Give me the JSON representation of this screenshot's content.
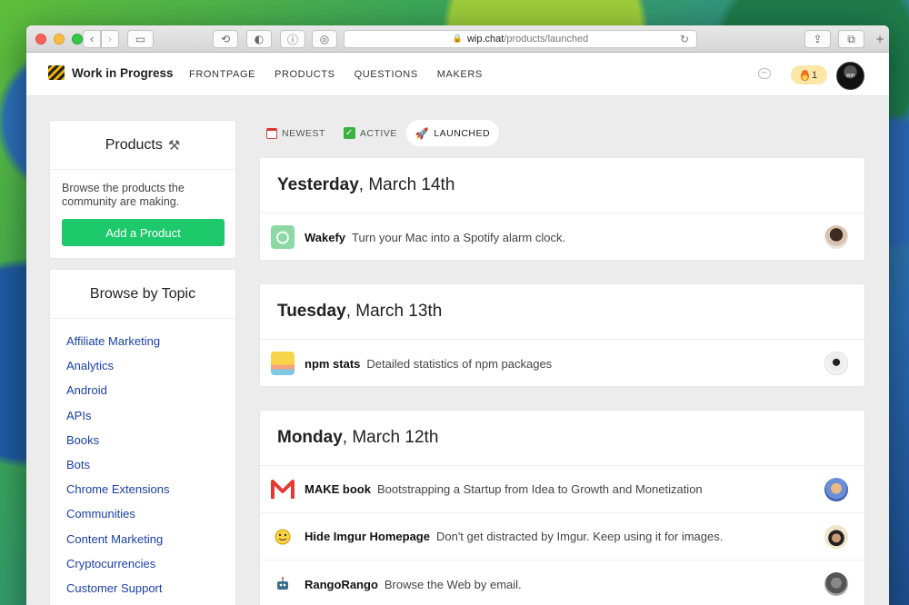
{
  "browser": {
    "url_domain": "wip.chat",
    "url_path": "/products/launched"
  },
  "header": {
    "logo_text": "Work in Progress",
    "nav": [
      "FRONTPAGE",
      "PRODUCTS",
      "QUESTIONS",
      "MAKERS"
    ],
    "streak_count": "1",
    "avatar_text": "WIP"
  },
  "sidebar": {
    "products_title": "Products",
    "products_desc": "Browse the products the community are making.",
    "add_button": "Add a Product",
    "topics_title": "Browse by Topic",
    "topics": [
      "Affiliate Marketing",
      "Analytics",
      "Android",
      "APIs",
      "Books",
      "Bots",
      "Chrome Extensions",
      "Communities",
      "Content Marketing",
      "Cryptocurrencies",
      "Customer Support"
    ]
  },
  "tabs": [
    {
      "label": "NEWEST",
      "icon": "calendar-icon",
      "active": false
    },
    {
      "label": "ACTIVE",
      "icon": "check-icon",
      "active": false
    },
    {
      "label": "LAUNCHED",
      "icon": "rocket-icon",
      "active": true
    }
  ],
  "days": [
    {
      "day": "Yesterday",
      "date": ", March 14th",
      "products": [
        {
          "name": "Wakefy",
          "desc": "Turn your Mac into a Spotify alarm clock.",
          "icon": "alarm-clock-icon"
        }
      ]
    },
    {
      "day": "Tuesday",
      "date": ", March 13th",
      "products": [
        {
          "name": "npm stats",
          "desc": "Detailed statistics of npm packages",
          "icon": "chart-icon"
        }
      ]
    },
    {
      "day": "Monday",
      "date": ", March 12th",
      "products": [
        {
          "name": "MAKE book",
          "desc": "Bootstrapping a Startup from Idea to Growth and Monetization",
          "icon": "m-logo-icon"
        },
        {
          "name": "Hide Imgur Homepage",
          "desc": "Don't get distracted by Imgur. Keep using it for images.",
          "icon": "imgur-icon"
        },
        {
          "name": "RangoRango",
          "desc": "Browse the Web by email.",
          "icon": "robot-icon"
        }
      ]
    }
  ],
  "colors": {
    "accent_green": "#1ec96b",
    "link_blue": "#1a3fa8",
    "streak_bg": "#fde7a7"
  }
}
